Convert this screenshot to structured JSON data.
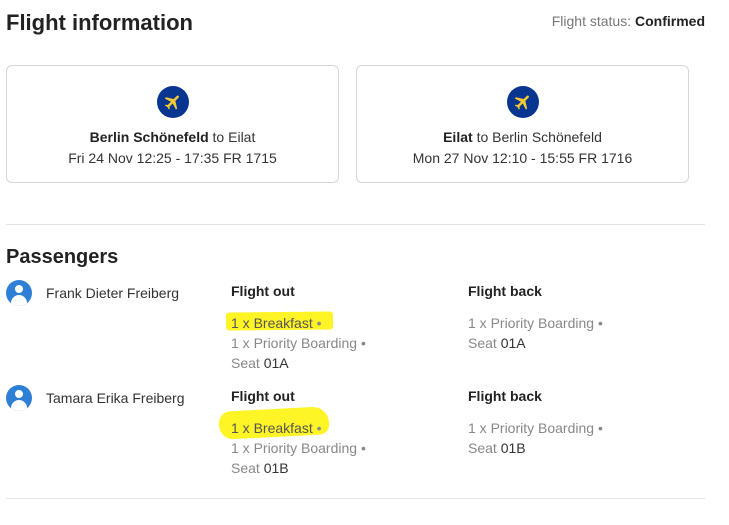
{
  "header": {
    "title": "Flight information",
    "status_label": "Flight status:",
    "status_value": "Confirmed"
  },
  "flights": [
    {
      "from": "Berlin Schönefeld",
      "connector": "to",
      "to": "Eilat",
      "times": "Fri 24 Nov 12:25 - 17:35 FR 1715",
      "icon": "plane-icon"
    },
    {
      "from": "Eilat",
      "connector": "to",
      "to": "Berlin Schönefeld",
      "times": "Mon 27 Nov 12:10 - 15:55 FR 1716",
      "icon": "plane-icon"
    }
  ],
  "passengers_section": {
    "title": "Passengers",
    "flight_out_label": "Flight out",
    "flight_back_label": "Flight back",
    "passengers": [
      {
        "name": "Frank Dieter Freiberg",
        "out": {
          "item1": "1 x Breakfast",
          "item2": "1 x Priority Boarding",
          "seat_label": "Seat",
          "seat": "01A"
        },
        "back": {
          "item1": "1 x Priority Boarding",
          "seat_label": "Seat",
          "seat": "01A"
        }
      },
      {
        "name": "Tamara Erika Freiberg",
        "out": {
          "item1": "1 x Breakfast",
          "item2": "1 x Priority Boarding",
          "seat_label": "Seat",
          "seat": "01B"
        },
        "back": {
          "item1": "1 x Priority Boarding",
          "seat_label": "Seat",
          "seat": "01B"
        }
      }
    ]
  },
  "colors": {
    "plane_badge": "#073590",
    "plane_glyph": "#f1c933",
    "avatar": "#2f7fd6",
    "highlight": "#fff200"
  }
}
